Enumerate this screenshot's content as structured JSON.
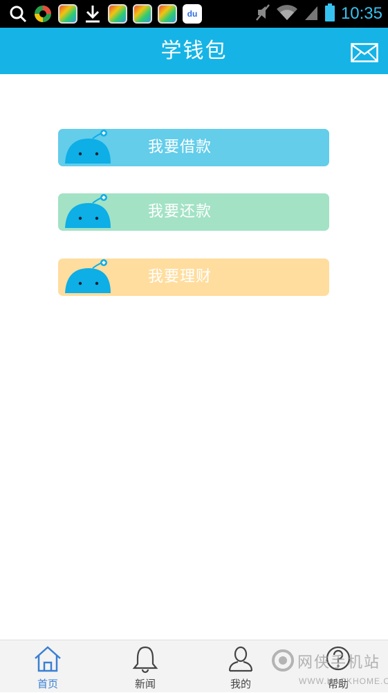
{
  "status_bar": {
    "time": "10:35",
    "left_icons": [
      "search-icon",
      "app-icon",
      "app-icon",
      "download-icon",
      "app-icon",
      "app-icon",
      "app-icon",
      "baidu-icon"
    ],
    "baidu_text": "du",
    "right_icons": [
      "mute-icon",
      "wifi-icon",
      "signal-icon",
      "battery-icon"
    ],
    "time_color": "#36c2f0"
  },
  "header": {
    "title": "学钱包",
    "background": "#16b4e6",
    "mail_icon": "mail-icon"
  },
  "actions": [
    {
      "label": "我要借款",
      "color": "#63cdea"
    },
    {
      "label": "我要还款",
      "color": "#a3e2c5"
    },
    {
      "label": "我要理财",
      "color": "#ffdd9e"
    }
  ],
  "tabs": [
    {
      "label": "首页",
      "icon": "home-icon",
      "active": true
    },
    {
      "label": "新闻",
      "icon": "bell-icon",
      "active": false
    },
    {
      "label": "我的",
      "icon": "user-icon",
      "active": false
    },
    {
      "label": "帮助",
      "icon": "help-icon",
      "active": false
    }
  ],
  "watermark": {
    "text_cn": "网侠手机站",
    "text_en": "WWW.HACKHOME.COM"
  },
  "colors": {
    "accent": "#16b4e6",
    "tab_active": "#3a7fd3"
  }
}
